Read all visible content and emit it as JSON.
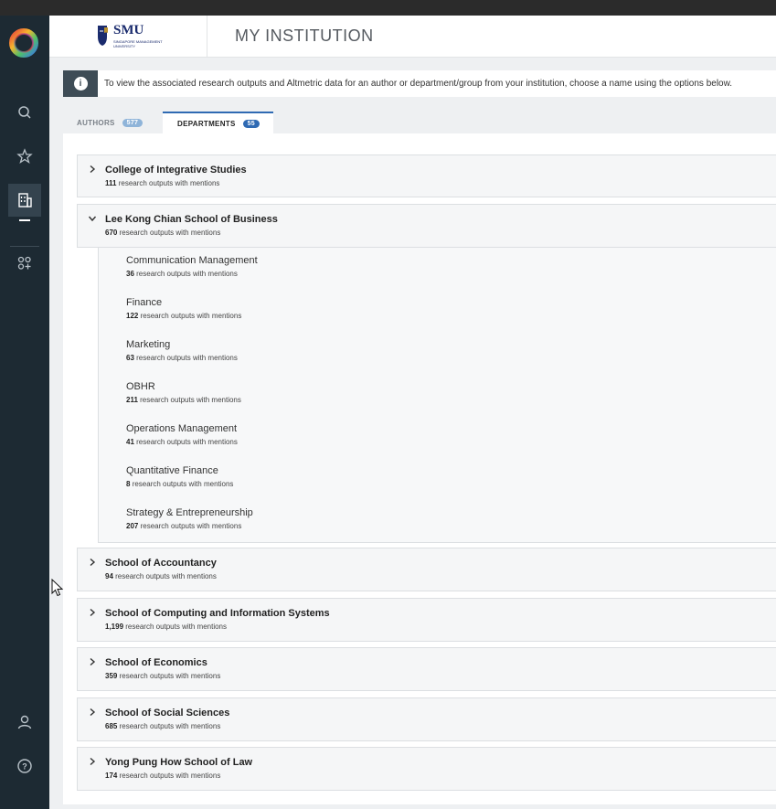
{
  "header": {
    "brand_name": "SMU",
    "brand_sub": "SINGAPORE MANAGEMENT UNIVERSITY",
    "title": "MY INSTITUTION"
  },
  "sidebar": {
    "items": [
      {
        "icon": "search-icon"
      },
      {
        "icon": "star-icon"
      },
      {
        "icon": "building-icon",
        "active": true
      },
      {
        "icon": "apps-icon"
      },
      {
        "icon": "user-icon"
      },
      {
        "icon": "help-icon"
      }
    ]
  },
  "info": {
    "text": "To view the associated research outputs and Altmetric data for an author or department/group from your institution, choose a name using the options below."
  },
  "tabs": [
    {
      "label": "AUTHORS",
      "count": "577"
    },
    {
      "label": "DEPARTMENTS",
      "count": "55",
      "active": true
    }
  ],
  "mentions_suffix": "research outputs with mentions",
  "departments": [
    {
      "name": "College of Integrative Studies",
      "count": "111"
    },
    {
      "name": "Lee Kong Chian School of Business",
      "count": "670",
      "expanded": true,
      "children": [
        {
          "name": "Communication Management",
          "count": "36"
        },
        {
          "name": "Finance",
          "count": "122"
        },
        {
          "name": "Marketing",
          "count": "63"
        },
        {
          "name": "OBHR",
          "count": "211"
        },
        {
          "name": "Operations Management",
          "count": "41"
        },
        {
          "name": "Quantitative Finance",
          "count": "8"
        },
        {
          "name": "Strategy & Entrepreneurship",
          "count": "207"
        }
      ]
    },
    {
      "name": "School of Accountancy",
      "count": "94"
    },
    {
      "name": "School of Computing and Information Systems",
      "count": "1,199"
    },
    {
      "name": "School of Economics",
      "count": "359"
    },
    {
      "name": "School of Social Sciences",
      "count": "685"
    },
    {
      "name": "Yong Pung How School of Law",
      "count": "174"
    }
  ],
  "colors": {
    "sidebar": "#1d2a33",
    "accent": "#2f6ab3",
    "badge_inactive": "#8fb4d9"
  }
}
